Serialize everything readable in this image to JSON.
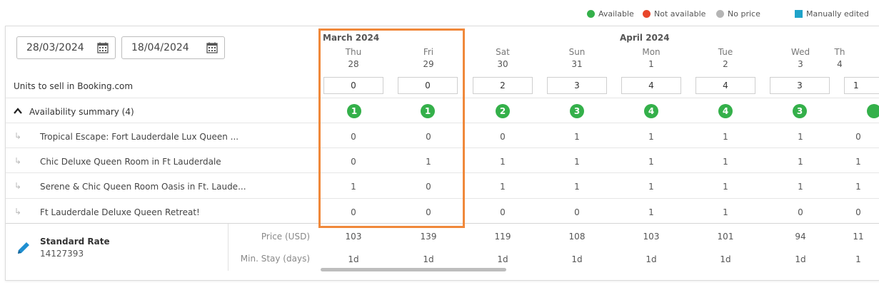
{
  "legend": {
    "available": "Available",
    "not_available": "Not available",
    "no_price": "No price",
    "manually_edited": "Manually edited",
    "colors": {
      "available": "#34b04a",
      "not_available": "#e8462b",
      "no_price": "#b5b5b5",
      "manually_edited": "#1fa3c9"
    }
  },
  "dates": {
    "start": "28/03/2024",
    "end": "18/04/2024"
  },
  "months": {
    "march": "March 2024",
    "april": "April 2024"
  },
  "columns": [
    {
      "dow": "Thu",
      "day": "28",
      "units": "0",
      "summary": "1",
      "rows": [
        "0",
        "0",
        "1",
        "0"
      ],
      "price": "103",
      "minstay": "1d"
    },
    {
      "dow": "Fri",
      "day": "29",
      "units": "0",
      "summary": "1",
      "rows": [
        "0",
        "1",
        "0",
        "0"
      ],
      "price": "139",
      "minstay": "1d"
    },
    {
      "dow": "Sat",
      "day": "30",
      "units": "2",
      "summary": "2",
      "rows": [
        "0",
        "1",
        "1",
        "0"
      ],
      "price": "119",
      "minstay": "1d"
    },
    {
      "dow": "Sun",
      "day": "31",
      "units": "3",
      "summary": "3",
      "rows": [
        "1",
        "1",
        "1",
        "0"
      ],
      "price": "108",
      "minstay": "1d"
    },
    {
      "dow": "Mon",
      "day": "1",
      "units": "4",
      "summary": "4",
      "rows": [
        "1",
        "1",
        "1",
        "1"
      ],
      "price": "103",
      "minstay": "1d"
    },
    {
      "dow": "Tue",
      "day": "2",
      "units": "4",
      "summary": "4",
      "rows": [
        "1",
        "1",
        "1",
        "1"
      ],
      "price": "101",
      "minstay": "1d"
    },
    {
      "dow": "Wed",
      "day": "3",
      "units": "3",
      "summary": "3",
      "rows": [
        "1",
        "1",
        "1",
        "0"
      ],
      "price": "94",
      "minstay": "1d"
    },
    {
      "dow": "Th",
      "day": "4",
      "units": "1",
      "summary": "",
      "rows": [
        "0",
        "1",
        "1",
        "0"
      ],
      "price": "11",
      "minstay": "1"
    }
  ],
  "labels": {
    "units_to_sell": "Units to sell in Booking.com",
    "availability_summary": "Availability summary (4)",
    "price": "Price (USD)",
    "min_stay": "Min. Stay (days)"
  },
  "rooms": [
    "Tropical Escape: Fort Lauderdale Lux Queen ...",
    "Chic Deluxe Queen Room in Ft Lauderdale",
    "Serene & Chic Queen Room Oasis in Ft. Laude...",
    "Ft Lauderdale Deluxe Queen Retreat!"
  ],
  "rate": {
    "name": "Standard Rate",
    "id": "14127393"
  }
}
